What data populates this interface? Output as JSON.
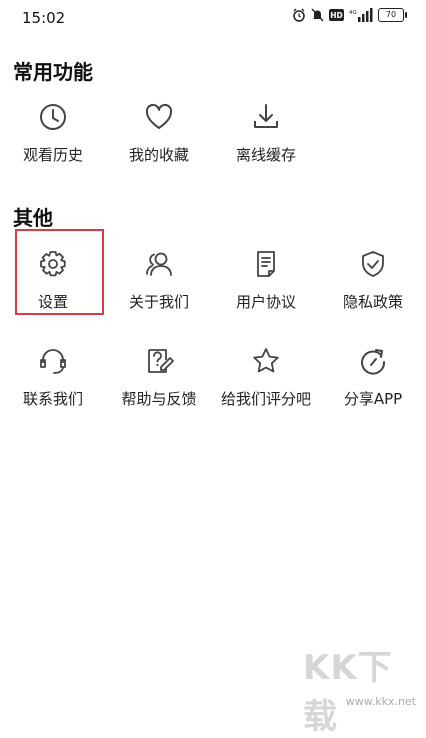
{
  "status_bar": {
    "time": "15:02",
    "battery": "70"
  },
  "sections": {
    "common_title": "常用功能",
    "other_title": "其他"
  },
  "common_items": [
    {
      "label": "观看历史",
      "icon": "clock-icon"
    },
    {
      "label": "我的收藏",
      "icon": "heart-icon"
    },
    {
      "label": "离线缓存",
      "icon": "download-icon"
    }
  ],
  "other_items": [
    {
      "label": "设置",
      "icon": "gear-icon"
    },
    {
      "label": "关于我们",
      "icon": "users-icon"
    },
    {
      "label": "用户协议",
      "icon": "document-icon"
    },
    {
      "label": "隐私政策",
      "icon": "shield-check-icon"
    },
    {
      "label": "联系我们",
      "icon": "headset-icon"
    },
    {
      "label": "帮助与反馈",
      "icon": "help-edit-icon"
    },
    {
      "label": "给我们评分吧",
      "icon": "star-icon"
    },
    {
      "label": "分享APP",
      "icon": "share-refresh-icon"
    }
  ],
  "colors": {
    "highlight": "#d63b46",
    "icon_stroke": "#444444"
  },
  "watermark": {
    "brand": "KK下载",
    "url": "www.kkx.net"
  }
}
